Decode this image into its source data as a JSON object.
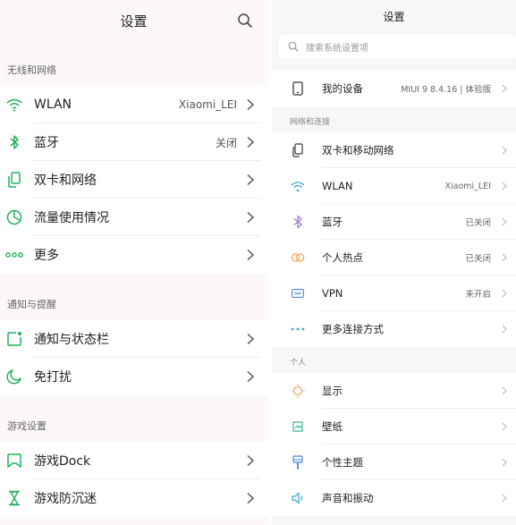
{
  "left": {
    "title": "设置",
    "sections": [
      {
        "header": "无线和网络",
        "items": [
          {
            "label": "WLAN",
            "value": "Xiaomi_LEI",
            "icon": "wifi-icon"
          },
          {
            "label": "蓝牙",
            "value": "关闭",
            "icon": "bluetooth-icon"
          },
          {
            "label": "双卡和网络",
            "value": "",
            "icon": "sim-icon"
          },
          {
            "label": "流量使用情况",
            "value": "",
            "icon": "data-usage-icon"
          },
          {
            "label": "更多",
            "value": "",
            "icon": "more-dots-icon"
          }
        ]
      },
      {
        "header": "通知与提醒",
        "items": [
          {
            "label": "通知与状态栏",
            "value": "",
            "icon": "notification-icon"
          },
          {
            "label": "免打扰",
            "value": "",
            "icon": "moon-icon"
          }
        ]
      },
      {
        "header": "游戏设置",
        "items": [
          {
            "label": "游戏Dock",
            "value": "",
            "icon": "game-dock-icon"
          },
          {
            "label": "游戏防沉迷",
            "value": "",
            "icon": "hourglass-icon"
          }
        ]
      }
    ]
  },
  "right": {
    "title": "设置",
    "search_placeholder": "搜索系统设置项",
    "device": {
      "label": "我的设备",
      "value": "MIUI 9 8.4.16 | 体验版"
    },
    "sections": [
      {
        "header": "网络和连接",
        "items": [
          {
            "label": "双卡和移动网络",
            "value": "",
            "icon": "sim-icon"
          },
          {
            "label": "WLAN",
            "value": "Xiaomi_LEI",
            "icon": "wifi-icon"
          },
          {
            "label": "蓝牙",
            "value": "已关闭",
            "icon": "bluetooth-icon"
          },
          {
            "label": "个人热点",
            "value": "已关闭",
            "icon": "hotspot-icon"
          },
          {
            "label": "VPN",
            "value": "未开启",
            "icon": "vpn-icon"
          },
          {
            "label": "更多连接方式",
            "value": "",
            "icon": "more-dots-icon"
          }
        ]
      },
      {
        "header": "个人",
        "items": [
          {
            "label": "显示",
            "value": "",
            "icon": "sun-icon"
          },
          {
            "label": "壁纸",
            "value": "",
            "icon": "wallpaper-icon"
          },
          {
            "label": "个性主题",
            "value": "",
            "icon": "theme-icon"
          },
          {
            "label": "声音和振动",
            "value": "",
            "icon": "speaker-icon"
          }
        ]
      }
    ]
  },
  "colors": {
    "left_accent": "#1fb15a",
    "right_accent": "#4a4a4a"
  }
}
